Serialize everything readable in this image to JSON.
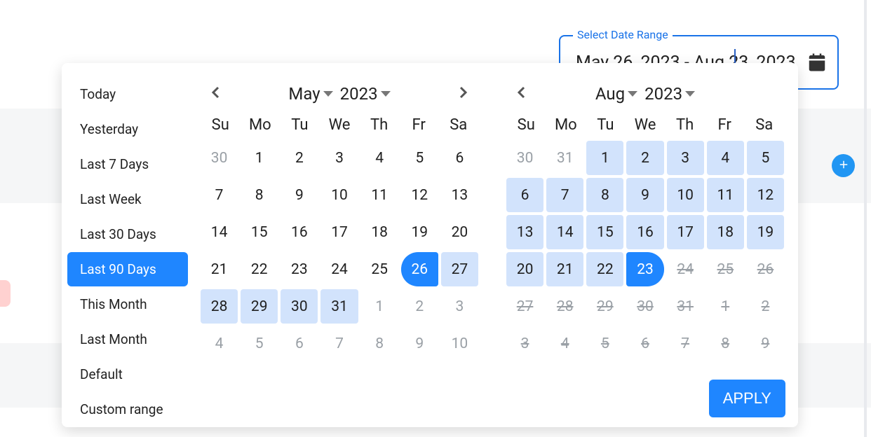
{
  "range": {
    "label": "Select Date Range",
    "value": "May 26, 2023 - Aug 23, 2023"
  },
  "apply_label": "APPLY",
  "presets": [
    {
      "label": "Today",
      "active": false
    },
    {
      "label": "Yesterday",
      "active": false
    },
    {
      "label": "Last 7 Days",
      "active": false
    },
    {
      "label": "Last Week",
      "active": false
    },
    {
      "label": "Last 30 Days",
      "active": false
    },
    {
      "label": "Last 90 Days",
      "active": true
    },
    {
      "label": "This Month",
      "active": false
    },
    {
      "label": "Last Month",
      "active": false
    },
    {
      "label": "Default",
      "active": false
    },
    {
      "label": "Custom range",
      "active": false
    }
  ],
  "weekdays": [
    "Su",
    "Mo",
    "Tu",
    "We",
    "Th",
    "Fr",
    "Sa"
  ],
  "calendars": [
    {
      "month": "May",
      "year": "2023",
      "days": [
        {
          "n": 30,
          "state": "out"
        },
        {
          "n": 1
        },
        {
          "n": 2
        },
        {
          "n": 3
        },
        {
          "n": 4
        },
        {
          "n": 5
        },
        {
          "n": 6
        },
        {
          "n": 7
        },
        {
          "n": 8
        },
        {
          "n": 9
        },
        {
          "n": 10
        },
        {
          "n": 11
        },
        {
          "n": 12
        },
        {
          "n": 13
        },
        {
          "n": 14
        },
        {
          "n": 15
        },
        {
          "n": 16
        },
        {
          "n": 17
        },
        {
          "n": 18
        },
        {
          "n": 19
        },
        {
          "n": 20
        },
        {
          "n": 21
        },
        {
          "n": 22
        },
        {
          "n": 23
        },
        {
          "n": 24
        },
        {
          "n": 25
        },
        {
          "n": 26,
          "state": "start"
        },
        {
          "n": 27,
          "state": "inrange"
        },
        {
          "n": 28,
          "state": "inrange"
        },
        {
          "n": 29,
          "state": "inrange"
        },
        {
          "n": 30,
          "state": "inrange"
        },
        {
          "n": 31,
          "state": "inrange"
        },
        {
          "n": 1,
          "state": "out"
        },
        {
          "n": 2,
          "state": "out"
        },
        {
          "n": 3,
          "state": "out"
        },
        {
          "n": 4,
          "state": "out"
        },
        {
          "n": 5,
          "state": "out"
        },
        {
          "n": 6,
          "state": "out"
        },
        {
          "n": 7,
          "state": "out"
        },
        {
          "n": 8,
          "state": "out"
        },
        {
          "n": 9,
          "state": "out"
        },
        {
          "n": 10,
          "state": "out"
        }
      ]
    },
    {
      "month": "Aug",
      "year": "2023",
      "days": [
        {
          "n": 30,
          "state": "out"
        },
        {
          "n": 31,
          "state": "out"
        },
        {
          "n": 1,
          "state": "inrange"
        },
        {
          "n": 2,
          "state": "inrange"
        },
        {
          "n": 3,
          "state": "inrange"
        },
        {
          "n": 4,
          "state": "inrange"
        },
        {
          "n": 5,
          "state": "inrange"
        },
        {
          "n": 6,
          "state": "inrange"
        },
        {
          "n": 7,
          "state": "inrange"
        },
        {
          "n": 8,
          "state": "inrange"
        },
        {
          "n": 9,
          "state": "inrange"
        },
        {
          "n": 10,
          "state": "inrange"
        },
        {
          "n": 11,
          "state": "inrange"
        },
        {
          "n": 12,
          "state": "inrange"
        },
        {
          "n": 13,
          "state": "inrange"
        },
        {
          "n": 14,
          "state": "inrange"
        },
        {
          "n": 15,
          "state": "inrange"
        },
        {
          "n": 16,
          "state": "inrange"
        },
        {
          "n": 17,
          "state": "inrange"
        },
        {
          "n": 18,
          "state": "inrange"
        },
        {
          "n": 19,
          "state": "inrange"
        },
        {
          "n": 20,
          "state": "inrange"
        },
        {
          "n": 21,
          "state": "inrange"
        },
        {
          "n": 22,
          "state": "inrange"
        },
        {
          "n": 23,
          "state": "end"
        },
        {
          "n": 24,
          "state": "disabled"
        },
        {
          "n": 25,
          "state": "disabled"
        },
        {
          "n": 26,
          "state": "disabled"
        },
        {
          "n": 27,
          "state": "disabled"
        },
        {
          "n": 28,
          "state": "disabled"
        },
        {
          "n": 29,
          "state": "disabled"
        },
        {
          "n": 30,
          "state": "disabled"
        },
        {
          "n": 31,
          "state": "disabled"
        },
        {
          "n": 1,
          "state": "disabled"
        },
        {
          "n": 2,
          "state": "disabled"
        },
        {
          "n": 3,
          "state": "disabled"
        },
        {
          "n": 4,
          "state": "disabled"
        },
        {
          "n": 5,
          "state": "disabled"
        },
        {
          "n": 6,
          "state": "disabled"
        },
        {
          "n": 7,
          "state": "disabled"
        },
        {
          "n": 8,
          "state": "disabled"
        },
        {
          "n": 9,
          "state": "disabled"
        }
      ]
    }
  ]
}
